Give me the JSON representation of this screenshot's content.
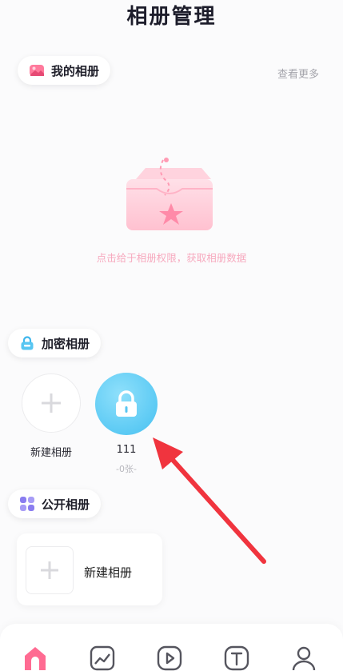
{
  "header": {
    "title": "相册管理"
  },
  "my_albums": {
    "label": "我的相册",
    "more": "查看更多",
    "empty_hint": "点击给于相册权限，获取相册数据"
  },
  "encrypted_albums": {
    "label": "加密相册",
    "new_label": "新建相册",
    "items": [
      {
        "name": "111",
        "count": "-0张-"
      }
    ]
  },
  "public_albums": {
    "label": "公开相册",
    "new_label": "新建相册"
  },
  "tabbar": {
    "icons": [
      "home-icon",
      "gallery-icon",
      "video-icon",
      "text-icon",
      "profile-icon"
    ]
  },
  "colors": {
    "pink": "#f7a9be",
    "blue": "#5ccaf4",
    "purple": "#8a7df0",
    "arrow": "#f0343e"
  }
}
